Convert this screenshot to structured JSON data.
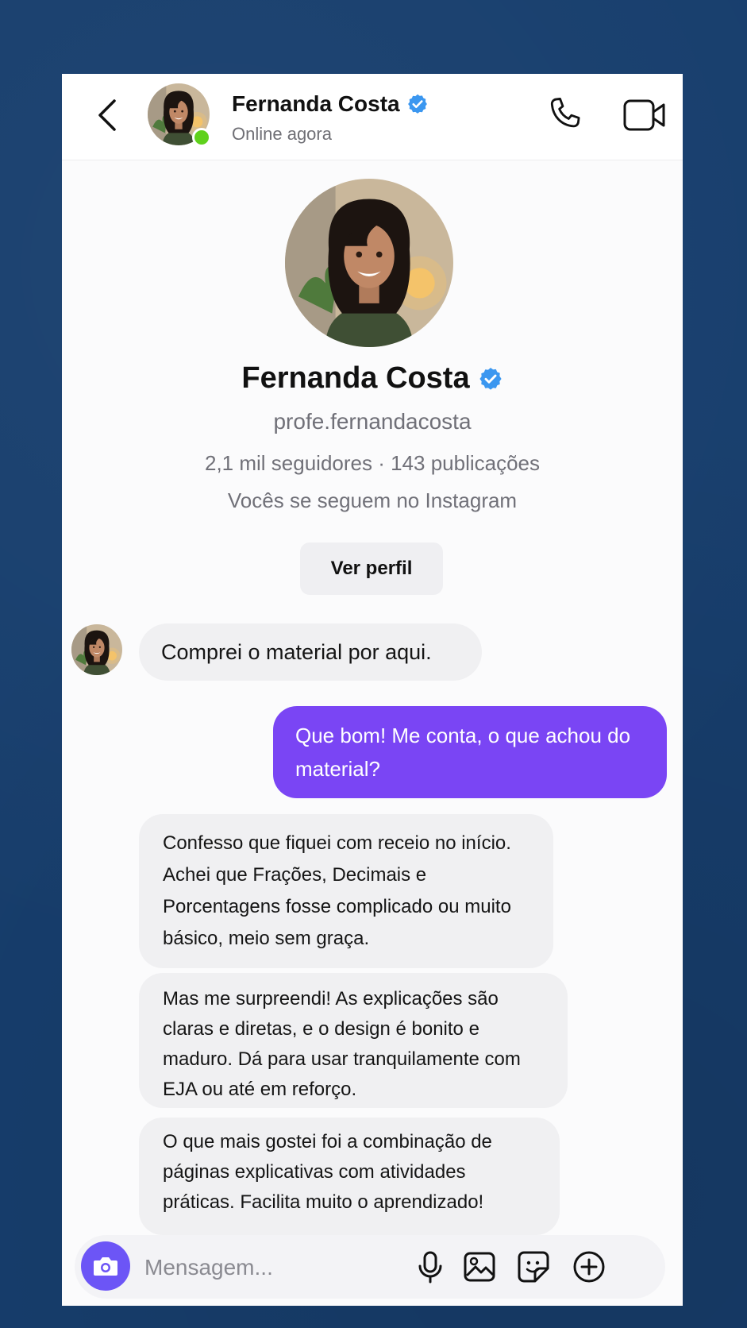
{
  "header": {
    "name": "Fernanda Costa",
    "status": "Online agora"
  },
  "profile": {
    "name": "Fernanda Costa",
    "handle": "profe.fernandacosta",
    "stats": "2,1 mil seguidores · 143 publicações",
    "mutual": "Vocês se seguem no Instagram",
    "view_profile_label": "Ver perfil"
  },
  "messages": [
    {
      "direction": "incoming",
      "text": "Comprei o material por aqui."
    },
    {
      "direction": "outgoing",
      "text": "Que bom! Me conta, o que achou do material?"
    },
    {
      "direction": "incoming",
      "text": "Confesso que fiquei com receio no início. Achei que Frações, Decimais e Porcentagens fosse complicado ou muito básico, meio sem graça."
    },
    {
      "direction": "incoming",
      "text": "Mas me surpreendi! As explicações são claras e diretas, e o design é bonito e maduro. Dá para usar tranquilamente com EJA ou até em reforço."
    },
    {
      "direction": "incoming",
      "text": "O que mais gostei foi a combinação de páginas explicativas com atividades práticas. Facilita muito o aprendizado!"
    }
  ],
  "composer": {
    "placeholder": "Mensagem..."
  },
  "colors": {
    "background": "#173e6d",
    "outgoing_bubble": "#7a45f4",
    "camera_button": "#6c55f6",
    "online": "#5fd11c",
    "verified": "#3b97f0"
  },
  "icons": [
    "back-arrow-icon",
    "verified-badge-icon",
    "phone-icon",
    "video-camera-icon",
    "camera-icon",
    "microphone-icon",
    "image-icon",
    "sticker-icon",
    "plus-circle-icon"
  ]
}
